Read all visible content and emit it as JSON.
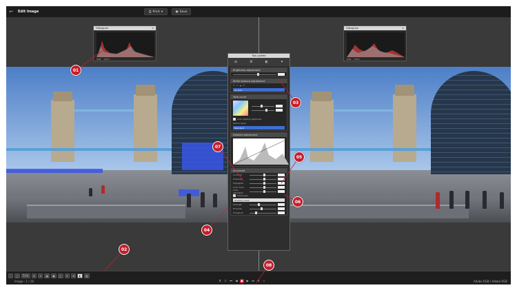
{
  "topbar": {
    "back_icon": "back-arrow-icon",
    "title": "Edit Image",
    "print_label": "Print",
    "save_label": "Save"
  },
  "histogram": {
    "title": "Histogram",
    "footer_left": "RGB",
    "footer_right": "100%"
  },
  "palette": {
    "title": "Tool palette",
    "tabs": [
      "⚖",
      "⚙",
      "◐",
      "✦"
    ],
    "brightness_label": "Brightness adjustment",
    "wb_label": "White balance adjustment",
    "wb_preset": "As shot",
    "tone_label": "Tone curve",
    "auto_lighting_label": "Auto Lighting Optimizer",
    "picture_style_label": "Picture Style",
    "picture_style_value": "Standard",
    "detail_label": "Detailed adjustment",
    "advanced_label": "Advanced",
    "contrast_label": "Contrast",
    "shadows_label": "Shadows",
    "highlights_label": "Highlights",
    "color_tone_label": "Color tone",
    "saturation_label": "Color saturation",
    "sharpness_label": "Sharpness",
    "unsharp_label": "Unsharp mask",
    "strength_label": "Strength",
    "fineness_label": "Fineness",
    "threshold_label": "Threshold"
  },
  "bottombar": {
    "zoom_value": "50%",
    "image_info": "Image : 1 / 18",
    "color_space": "Adobe RGB / Adobe RGB"
  },
  "callouts": [
    "01",
    "02",
    "03",
    "04",
    "05",
    "06",
    "07",
    "08"
  ],
  "colors": {
    "callout": "#c41f2d",
    "clipping_highlight": "#3a56e6",
    "background": "#3a3a3a"
  }
}
